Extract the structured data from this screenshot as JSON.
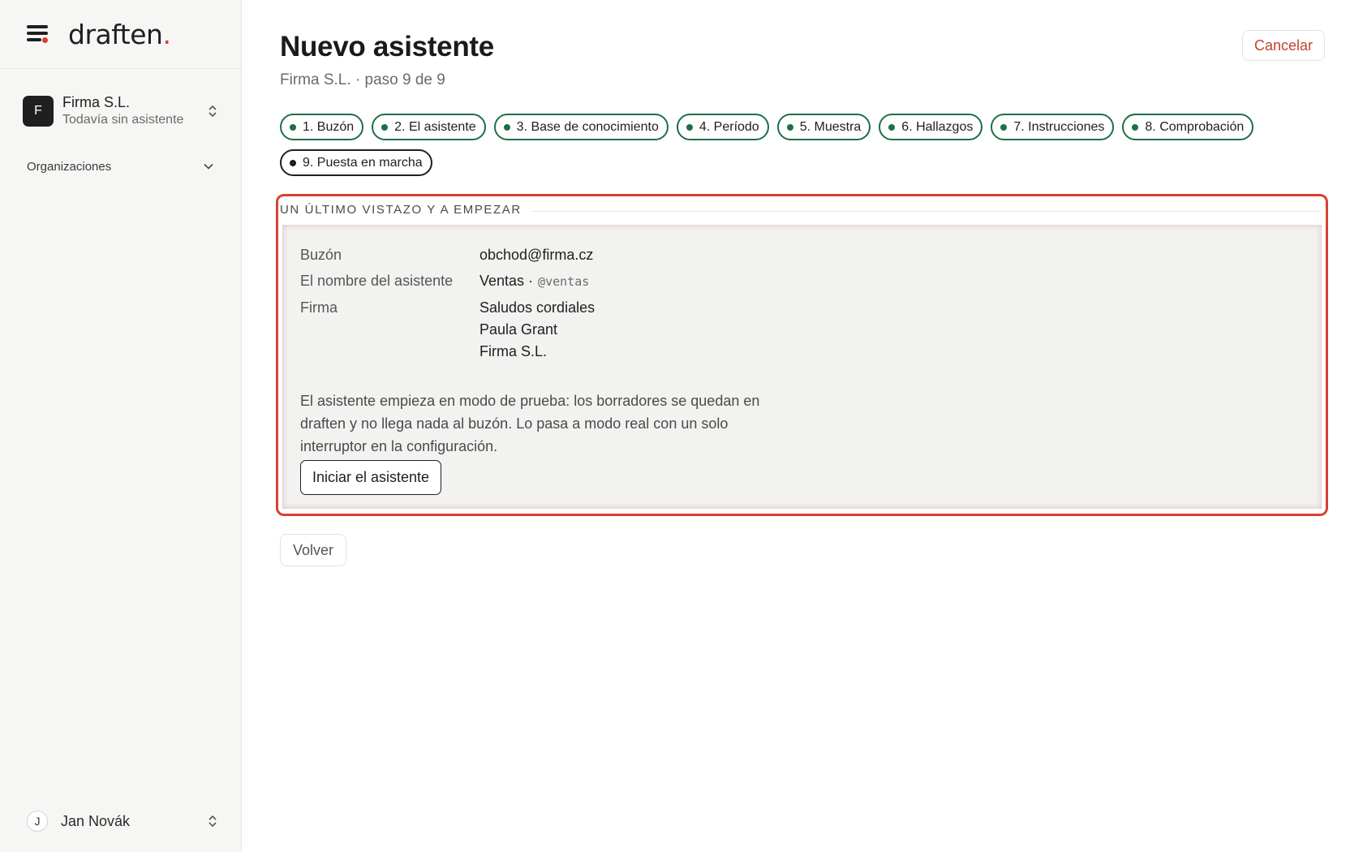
{
  "app": {
    "logo_text": "draften",
    "logo_dot": "."
  },
  "sidebar": {
    "org": {
      "avatar_letter": "F",
      "name": "Firma S.L.",
      "subtitle": "Todavía sin asistente"
    },
    "section_label": "Organizaciones",
    "user": {
      "avatar_letter": "J",
      "name": "Jan Novák"
    }
  },
  "header": {
    "title": "Nuevo asistente",
    "subtitle": "Firma S.L. · paso 9 de 9",
    "cancel_label": "Cancelar"
  },
  "steps": [
    {
      "label": "1. Buzón",
      "state": "done"
    },
    {
      "label": "2. El asistente",
      "state": "done"
    },
    {
      "label": "3. Base de conocimiento",
      "state": "done"
    },
    {
      "label": "4. Período",
      "state": "done"
    },
    {
      "label": "5. Muestra",
      "state": "done"
    },
    {
      "label": "6. Hallazgos",
      "state": "done"
    },
    {
      "label": "7. Instrucciones",
      "state": "done"
    },
    {
      "label": "8. Comprobación",
      "state": "done"
    },
    {
      "label": "9. Puesta en marcha",
      "state": "current"
    }
  ],
  "review": {
    "heading": "UN ÚLTIMO VISTAZO Y A EMPEZAR",
    "rows": {
      "mailbox_label": "Buzón",
      "mailbox_value": "obchod@firma.cz",
      "name_label": "El nombre del asistente",
      "name_value": "Ventas ·",
      "name_handle": "@ventas",
      "signature_label": "Firma",
      "signature_line1": "Saludos cordiales",
      "signature_line2": "Paula Grant",
      "signature_line3": "Firma S.L."
    },
    "note": "El asistente empieza en modo de prueba: los borradores se quedan en draften y no llega nada al buzón. Lo pasa a modo real con un solo interruptor en la configuración.",
    "start_label": "Iniciar el asistente"
  },
  "footer": {
    "back_label": "Volver"
  },
  "colors": {
    "accent_red": "#d9402f",
    "step_green": "#1e6e47",
    "sidebar_bg": "#f6f6f4"
  }
}
